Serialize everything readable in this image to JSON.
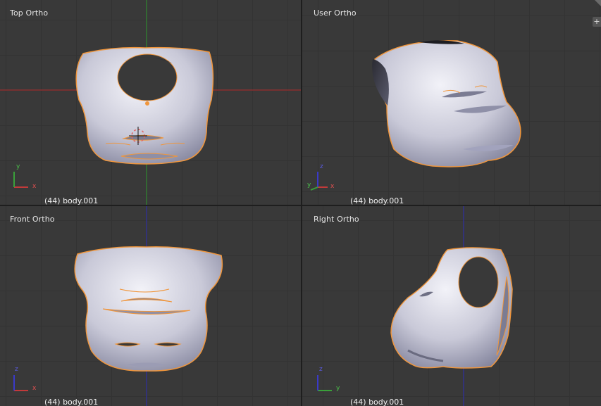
{
  "viewports": [
    {
      "title": "Top Ortho",
      "object_info": "(44) body.001",
      "axes": [
        "y",
        "x"
      ]
    },
    {
      "title": "User Ortho",
      "object_info": "(44) body.001",
      "axes": [
        "z",
        "y",
        "x"
      ]
    },
    {
      "title": "Front Ortho",
      "object_info": "(44) body.001",
      "axes": [
        "z",
        "x"
      ]
    },
    {
      "title": "Right Ortho",
      "object_info": "(44) body.001",
      "axes": [
        "z",
        "y"
      ]
    }
  ],
  "corner_button_label": "+",
  "colors": {
    "viewport_bg": "#393939",
    "grid": "#333333",
    "x_axis": "#b52d2d",
    "y_axis": "#2f9a2f",
    "z_axis": "#2f2fb8",
    "selection_outline": "#f0963c",
    "mesh_light": "#e6e6ef",
    "mesh_dark": "#7c7d8f"
  }
}
